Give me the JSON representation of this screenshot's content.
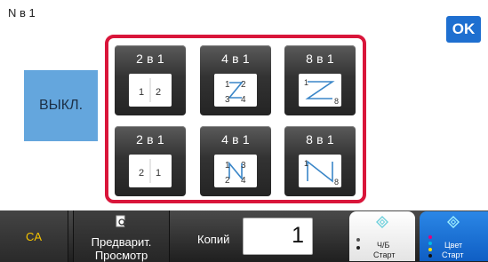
{
  "header": {
    "title": "N в 1",
    "ok_label": "OK"
  },
  "off_label": "ВЫКЛ.",
  "layouts": [
    {
      "label": "2 в 1",
      "icon": "2-in-1-left-to-right-icon"
    },
    {
      "label": "4 в 1",
      "icon": "4-in-1-z-order-icon"
    },
    {
      "label": "8 в 1",
      "icon": "8-in-1-z-order-icon"
    },
    {
      "label": "2 в 1",
      "icon": "2-in-1-right-to-left-icon"
    },
    {
      "label": "4 в 1",
      "icon": "4-in-1-n-order-icon"
    },
    {
      "label": "8 в 1",
      "icon": "8-in-1-n-order-icon"
    }
  ],
  "page_numbers": {
    "lr": [
      "1",
      "2"
    ],
    "rl": [
      "2",
      "1"
    ],
    "four_z": [
      "1",
      "2",
      "3",
      "4"
    ],
    "four_n": [
      "1",
      "3",
      "2",
      "4"
    ],
    "eight_start": "1",
    "eight_end": "8"
  },
  "bottom_bar": {
    "ca_label": "CA",
    "preview_line1": "Предварит.",
    "preview_line2": "Просмотр",
    "copies_label": "Копий",
    "copies_value": "1",
    "bw_line1": "Ч/Б",
    "bw_line2": "Старт",
    "color_line1": "Цвет",
    "color_line2": "Старт"
  },
  "colors": {
    "accent": "#1e6fd0",
    "selection_frame": "#d9153a",
    "off_button": "#64a6dd",
    "ca_text": "#f5c400",
    "arrow": "#3a86c8"
  }
}
